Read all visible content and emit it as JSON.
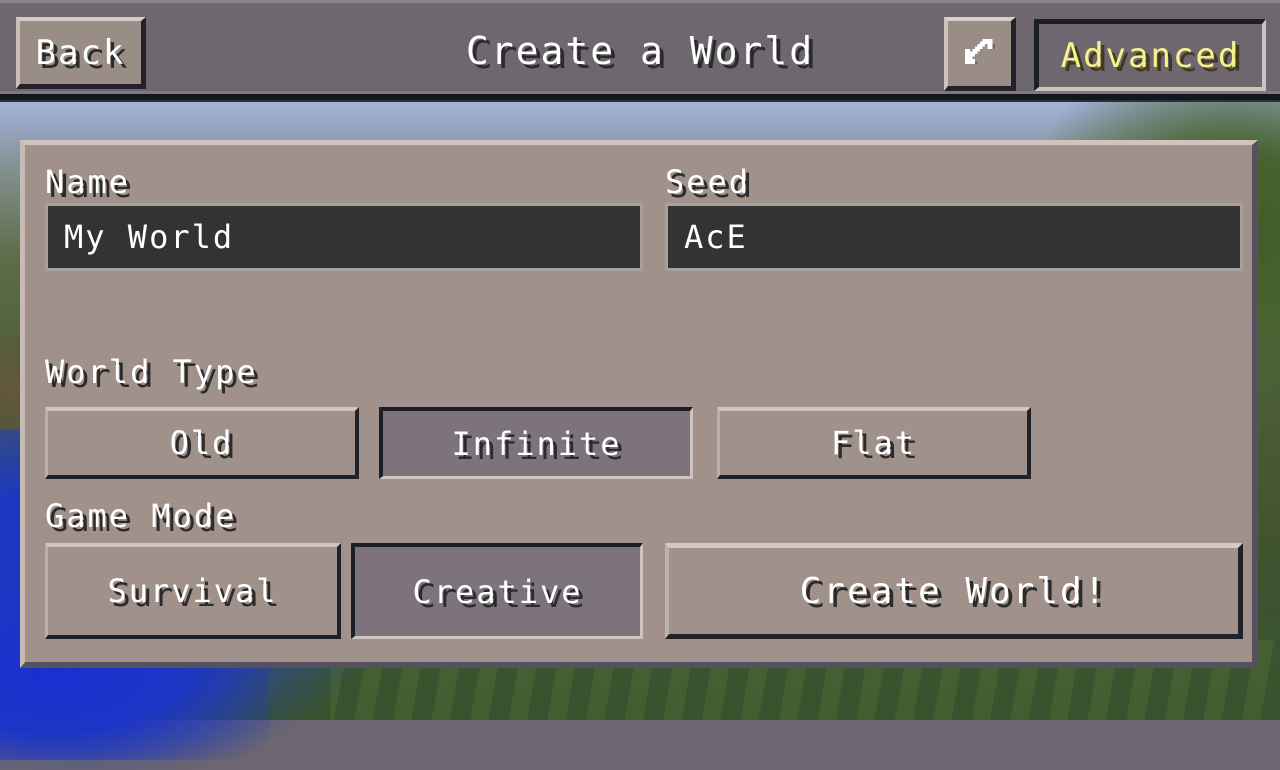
{
  "header": {
    "back_label": "Back",
    "title": "Create a World",
    "shuffle_icon": "shuffle-arrows-icon",
    "advanced_label": "Advanced",
    "advanced_color": "#f8f08a"
  },
  "form": {
    "name": {
      "label": "Name",
      "value": "My World",
      "placeholder": "My World"
    },
    "seed": {
      "label": "Seed",
      "value": "AcE",
      "placeholder": "Seed"
    },
    "world_type": {
      "label": "World Type",
      "options": [
        {
          "label": "Old",
          "selected": false
        },
        {
          "label": "Infinite",
          "selected": true
        },
        {
          "label": "Flat",
          "selected": false
        }
      ]
    },
    "game_mode": {
      "label": "Game Mode",
      "options": [
        {
          "label": "Survival",
          "selected": false
        },
        {
          "label": "Creative",
          "selected": true
        }
      ]
    },
    "create_label": "Create World!"
  },
  "colors": {
    "panel_bg": "#a0918a",
    "topbar_bg": "#6e6770",
    "input_bg": "#333333",
    "selected_bg": "#7d737c",
    "text": "#ffffff",
    "accent_yellow": "#f8f08a"
  }
}
